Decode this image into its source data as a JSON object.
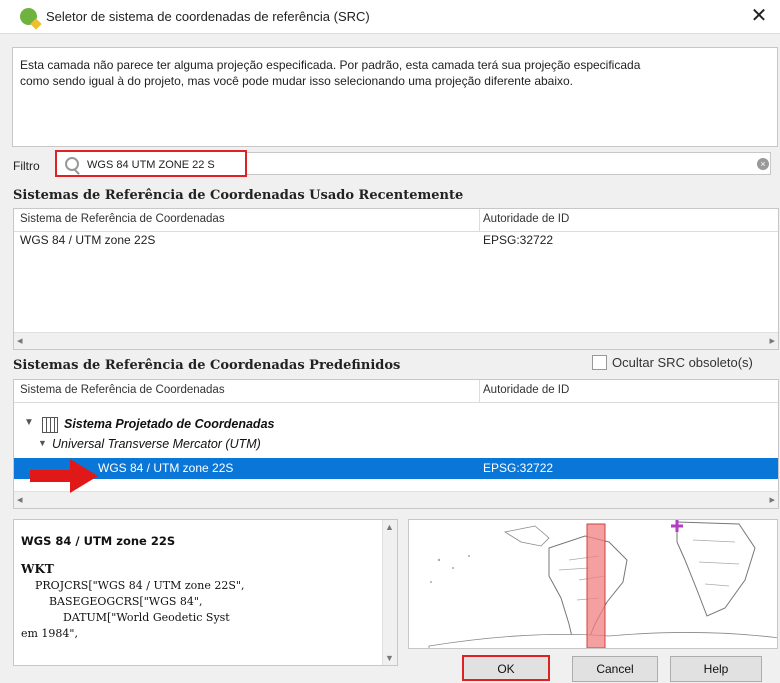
{
  "window": {
    "title": "Seletor de sistema de coordenadas de referência (SRC)",
    "close_glyph": "✕"
  },
  "message": "Esta camada não parece ter alguma projeção especificada. Por padrão, esta camada terá sua projeção especificada\ncomo sendo igual à do projeto, mas você pode mudar isso selecionando uma projeção diferente abaixo.",
  "filter": {
    "label": "Filtro",
    "value": "WGS 84 UTM ZONE 22 S"
  },
  "recent": {
    "title": "Sistemas de Referência de Coordenadas Usado Recentemente",
    "columns": [
      "Sistema de Referência de Coordenadas",
      "Autoridade de ID"
    ],
    "rows": [
      {
        "name": "WGS 84 / UTM zone 22S",
        "id": "EPSG:32722"
      }
    ]
  },
  "predefined": {
    "title": "Sistemas de Referência de Coordenadas Predefinidos",
    "hide_deprecated_label": "Ocultar SRC obsoleto(s)",
    "columns": [
      "Sistema de Referência de Coordenadas",
      "Autoridade de ID"
    ],
    "tree": {
      "group": "Sistema Projetado de Coordenadas",
      "subgroup": "Universal Transverse Mercator (UTM)",
      "selected_name": "WGS 84 / UTM zone 22S",
      "selected_id": "EPSG:32722"
    }
  },
  "details": {
    "name": "WGS 84 / UTM zone 22S",
    "wkt_label": "WKT",
    "wkt_lines": [
      "    PROJCRS[\"WGS 84 / UTM zone 22S\",",
      "        BASEGEOGCRS[\"WGS 84\",",
      "            DATUM[\"World Geodetic Syst",
      "em 1984\","
    ]
  },
  "buttons": {
    "ok": "OK",
    "cancel": "Cancel",
    "help": "Help"
  },
  "colors": {
    "selection": "#0a76d8",
    "highlight_red": "#dd2222",
    "map_band": "#f08080",
    "crosshair": "#b040c0"
  },
  "icons": {
    "app": "qgis-icon",
    "filter": "search-icon",
    "clear": "clear-icon",
    "tree_group": "grid-icon",
    "arrow": "red-arrow-icon"
  }
}
